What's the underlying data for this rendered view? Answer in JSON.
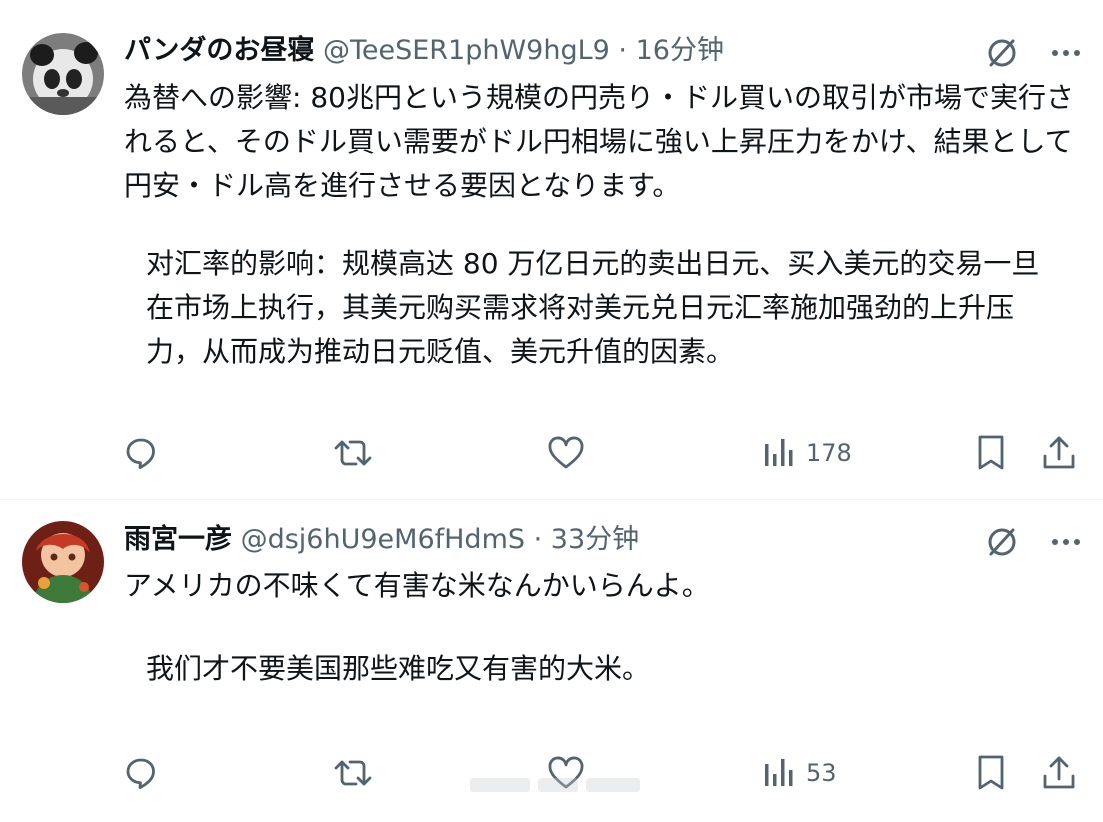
{
  "tweets": [
    {
      "display_name": "パンダのお昼寝",
      "handle": "@TeeSER1phW9hgL9",
      "separator": "·",
      "time": "16分钟",
      "text_ja": "為替への影響: 80兆円という規模の円売り・ドル買いの取引が市場で実行されると、そのドル買い需要がドル円相場に強い上昇圧力をかけ、結果として円安・ドル高を進行させる要因となります。",
      "text_zh": "对汇率的影响：规模高达 80 万亿日元的卖出日元、买入美元的交易一旦在市场上执行，其美元购买需求将对美元兑日元汇率施加强劲的上升压力，从而成为推动日元贬值、美元升值的因素。",
      "views": "178"
    },
    {
      "display_name": "雨宮一彦",
      "handle": "@dsj6hU9eM6fHdmS",
      "separator": "·",
      "time": "33分钟",
      "text_ja": "アメリカの不味くて有害な米なんかいらんよ。",
      "text_zh": "我们才不要美国那些难吃又有害的大米。",
      "views": "53"
    }
  ],
  "icons": {
    "translate": "translate-icon",
    "more": "more-icon",
    "reply": "reply-icon",
    "retweet": "retweet-icon",
    "like": "like-icon",
    "views": "views-icon",
    "bookmark": "bookmark-icon",
    "share": "share-icon"
  },
  "colors": {
    "text": "#0f1419",
    "secondary": "#536471",
    "divider": "#eff3f4",
    "background": "#ffffff"
  }
}
